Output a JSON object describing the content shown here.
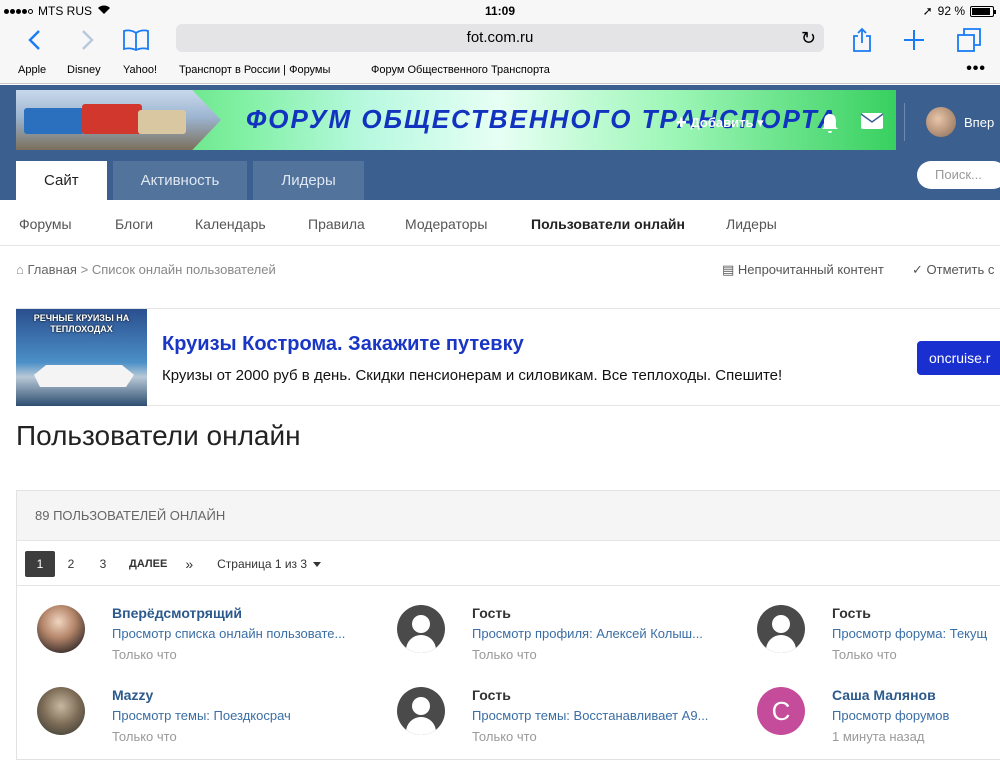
{
  "status": {
    "carrier": "MTS RUS",
    "time": "11:09",
    "battery": "92 %"
  },
  "browser": {
    "url": "fot.com.ru",
    "bookmarks": [
      "Apple",
      "Disney",
      "Yahoo!",
      "Транспорт в России | Форумы",
      "Форум Общественного Транспорта"
    ],
    "more": "•••"
  },
  "header": {
    "logo_title": "ФОРУМ  ОБЩЕСТВЕННОГО  ТРАНСПОРТА",
    "add_label": "✚ Добавить ▾",
    "user_label": "Впер",
    "tabs": [
      "Сайт",
      "Активность",
      "Лидеры"
    ],
    "search_placeholder": "Поиск..."
  },
  "subnav": [
    "Форумы",
    "Блоги",
    "Календарь",
    "Правила",
    "Модераторы",
    "Пользователи онлайн",
    "Лидеры"
  ],
  "breadcrumb": {
    "home": "Главная",
    "sep": ">",
    "current": "Список онлайн пользователей"
  },
  "topright": {
    "unread": "Непрочитанный контент",
    "mark": "Отметить с"
  },
  "ad": {
    "image_label": "РЕЧНЫЕ КРУИЗЫ НА ТЕПЛОХОДАХ",
    "title": "Круизы Кострома. Закажите путевку",
    "text": "Круизы от 2000 руб в день. Скидки пенсионерам и силовикам. Все теплоходы. Спешите!",
    "button": "oncruise.r"
  },
  "page_title": "Пользователи онлайн",
  "box": {
    "heading": "89 ПОЛЬЗОВАТЕЛЕЙ ОНЛАЙН",
    "pager": {
      "pages": [
        "1",
        "2",
        "3"
      ],
      "next": "ДАЛЕЕ",
      "last": "»",
      "page_of": "Страница 1 из 3"
    }
  },
  "users": [
    {
      "name": "Вперёдсмотрящий",
      "activity": "Просмотр списка онлайн пользовате...",
      "time": "Только что"
    },
    {
      "name": "Гость",
      "activity": "Просмотр профиля: Алексей Колыш...",
      "time": "Только что"
    },
    {
      "name": "Гость",
      "activity": "Просмотр форума: Текущ",
      "time": "Только что"
    },
    {
      "name": "Mazzy",
      "activity": "Просмотр темы: Поездкосрач",
      "time": "Только что"
    },
    {
      "name": "Гость",
      "activity": "Просмотр темы: Восстанавливает А9...",
      "time": "Только что"
    },
    {
      "name": "Саша Малянов",
      "activity": "Просмотр форумов",
      "time": "1 минута назад",
      "avatar_letter": "C"
    }
  ],
  "colors": {
    "header_bg": "#3b5f8f",
    "link": "#2c5a8c",
    "ad_title": "#1a36c4",
    "ad_button": "#1a2fd0",
    "letter_avatar": "#c44c9a"
  }
}
